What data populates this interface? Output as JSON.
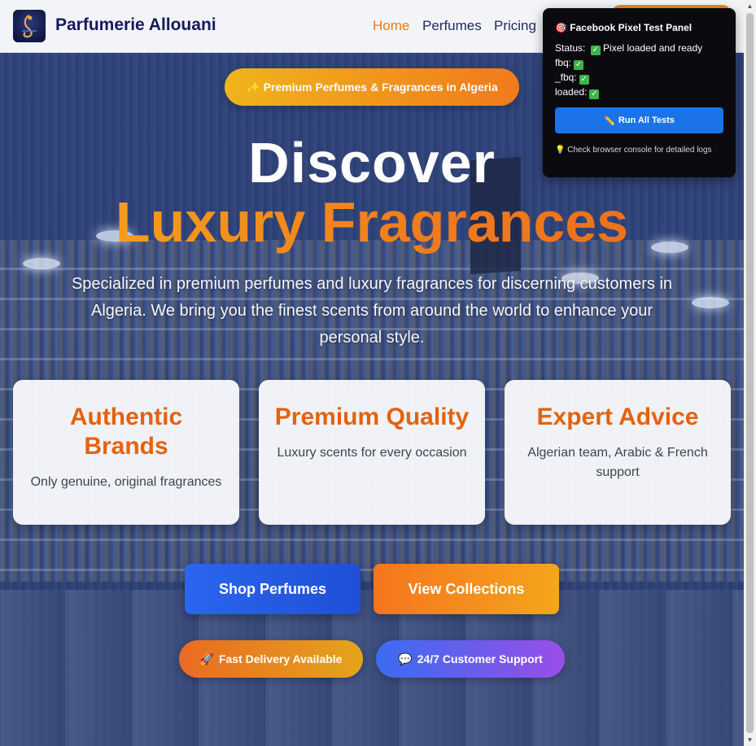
{
  "header": {
    "brand": "Parfumerie Allouani",
    "nav": {
      "home": "Home",
      "perfumes": "Perfumes",
      "pricing": "Pricing"
    }
  },
  "hero": {
    "badge": "✨ Premium Perfumes & Fragrances in Algeria",
    "title_line1": "Discover",
    "title_line2": "Luxury Fragrances",
    "subtitle": "Specialized in premium perfumes and luxury fragrances for discerning customers in Algeria. We bring you the finest scents from around the world to enhance your personal style.",
    "cards": [
      {
        "title": "Authentic Brands",
        "text": "Only genuine, original fragrances"
      },
      {
        "title": "Premium Quality",
        "text": "Luxury scents for every occasion"
      },
      {
        "title": "Expert Advice",
        "text": "Algerian team, Arabic & French support"
      }
    ],
    "buttons": {
      "shop": "Shop Perfumes",
      "collections": "View Collections"
    },
    "pills": {
      "delivery": "Fast Delivery Available",
      "support": "24/7 Customer Support"
    }
  },
  "pixel_panel": {
    "title": "Facebook Pixel Test Panel",
    "status_label": "Status:",
    "status_value": "Pixel loaded and ready",
    "fbq_label": "fbq:",
    "_fbq_label": "_fbq:",
    "loaded_label": "loaded:",
    "run_button": "Run All Tests",
    "hint": "Check browser console for detailed logs"
  },
  "icons": {
    "logo": "perfume-bottle-icon",
    "target": "target-icon",
    "check": "check-icon",
    "pencil": "pencil-icon",
    "bulb": "bulb-icon",
    "rocket": "rocket-icon",
    "speech": "speech-bubble-icon"
  },
  "colors": {
    "accent_orange": "#f07a1c",
    "brand_navy": "#141a5c",
    "primary_blue": "#1f4fd6",
    "check_green": "#3bb54a"
  }
}
